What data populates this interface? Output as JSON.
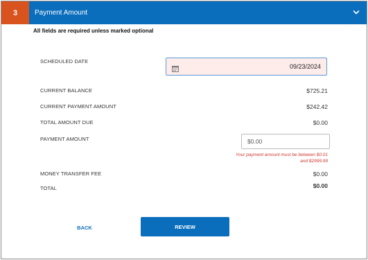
{
  "header": {
    "step_number": "3",
    "title": "Payment Amount",
    "expand_icon": "chevron-down-icon"
  },
  "form": {
    "required_note": "All fields are required unless marked optional",
    "scheduled_date": {
      "label": "SCHEDULED DATE",
      "value": "09/23/2024",
      "icon": "calendar-icon"
    },
    "current_balance": {
      "label": "CURRENT BALANCE",
      "value": "$725.21"
    },
    "current_payment_amount": {
      "label": "CURRENT PAYMENT AMOUNT",
      "value": "$242.42"
    },
    "total_amount_due": {
      "label": "TOTAL AMOUNT DUE",
      "value": "$0.00"
    },
    "payment_amount": {
      "label": "PAYMENT AMOUNT",
      "placeholder": "$0.00",
      "error": "Your payment amount must be between $0.01 and $2999.99"
    },
    "money_transfer_fee": {
      "label": "MONEY TRANSFER FEE",
      "value": "$0.00"
    },
    "total": {
      "label": "TOTAL",
      "value": "$0.00"
    }
  },
  "actions": {
    "back_label": "BACK",
    "review_label": "REVIEW"
  },
  "colors": {
    "header_blue": "#0a6ebd",
    "step_orange": "#d9531e",
    "error_red": "#d0342c",
    "date_field_bg": "#fdecea"
  }
}
